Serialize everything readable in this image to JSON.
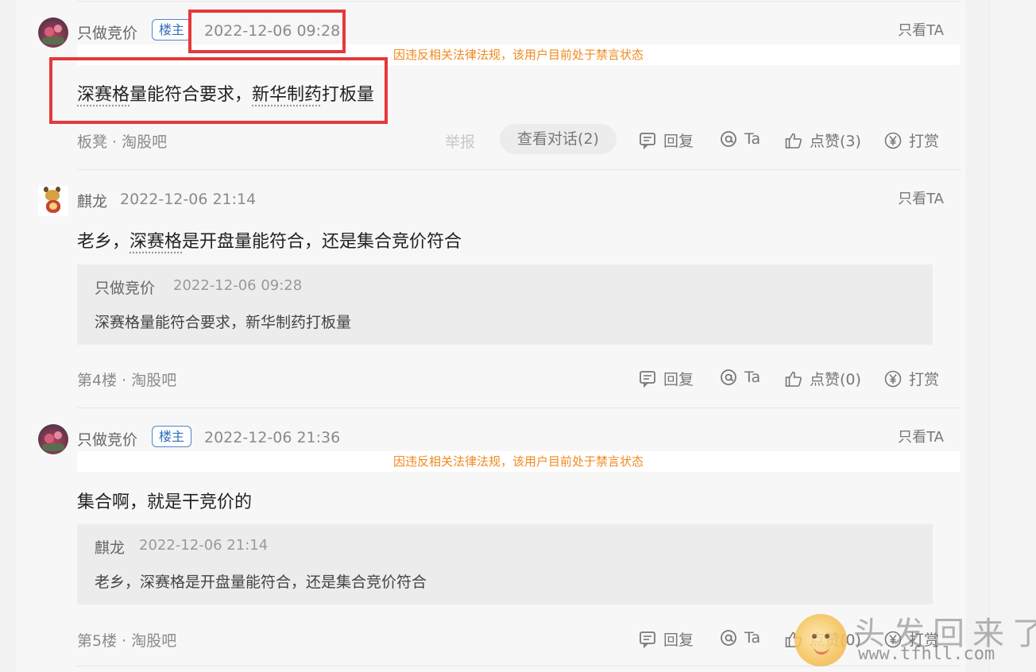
{
  "posts": [
    {
      "username": "只做竞价",
      "owner_badge": "楼主",
      "time": "2022-12-06 09:28",
      "only_ta": "只看TA",
      "ban_notice": "因违反相关法律法规，该用户目前处于禁言状态",
      "content": {
        "kw1": "深赛格",
        "mid": "量能符合要求，",
        "kw2": "新华制药",
        "tail": "打板量"
      },
      "floor": "板凳 · 淘股吧",
      "report": "举报",
      "view_conversation": "查看对话(2)",
      "actions": {
        "reply": "回复",
        "at": "Ta",
        "like": "点赞(3)",
        "tip": "打赏"
      }
    },
    {
      "username": "麒龙",
      "time": "2022-12-06 21:14",
      "only_ta": "只看TA",
      "content": {
        "head": "老乡，",
        "kw1": "深赛格",
        "tail": "是开盘量能符合，还是集合竞价符合"
      },
      "quote": {
        "username": "只做竞价",
        "time": "2022-12-06 09:28",
        "text": "深赛格量能符合要求，新华制药打板量"
      },
      "floor": "第4楼 · 淘股吧",
      "actions": {
        "reply": "回复",
        "at": "Ta",
        "like": "点赞(0)",
        "tip": "打赏"
      }
    },
    {
      "username": "只做竞价",
      "owner_badge": "楼主",
      "time": "2022-12-06 21:36",
      "only_ta": "只看TA",
      "ban_notice": "因违反相关法律法规，该用户目前处于禁言状态",
      "content_text": "集合啊，就是干竞价的",
      "quote": {
        "username": "麒龙",
        "time": "2022-12-06 21:14",
        "text": "老乡，深赛格是开盘量能符合，还是集合竞价符合"
      },
      "floor": "第5楼 · 淘股吧",
      "actions": {
        "reply": "回复",
        "at": "Ta",
        "like": "点赞(0)",
        "tip": "打赏"
      }
    }
  ],
  "watermark": {
    "title": "头发回来了",
    "url": "www.tfhll.com"
  },
  "colors": {
    "ban_notice": "#ef8a1f",
    "owner_badge": "#2f6db7",
    "highlight_box": "#e5383b"
  }
}
